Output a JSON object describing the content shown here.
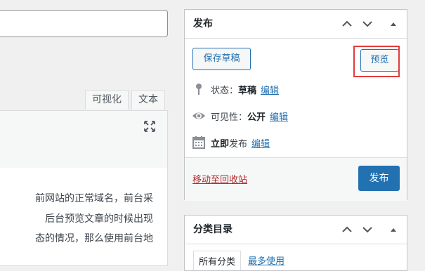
{
  "editor": {
    "tabs": [
      "可视化",
      "文本"
    ],
    "content_lines": [
      "前网站的正常域名，前台采",
      "后台预览文章的时候出现",
      "态的情况，那么使用前台地"
    ]
  },
  "publish_box": {
    "title": "发布",
    "save_draft_label": "保存草稿",
    "preview_label": "预览",
    "status": {
      "label": "状态：",
      "value": "草稿",
      "edit": "编辑"
    },
    "visibility": {
      "label": "可见性：",
      "value": "公开",
      "edit": "编辑"
    },
    "schedule": {
      "value": "立即",
      "suffix": "发布",
      "edit": "编辑"
    },
    "trash_label": "移动至回收站",
    "publish_label": "发布"
  },
  "category_box": {
    "title": "分类目录",
    "tab_all": "所有分类",
    "tab_popular": "最多使用"
  },
  "colors": {
    "primary": "#2271b1",
    "highlight": "#e53a3a",
    "trash": "#b32d2e"
  }
}
